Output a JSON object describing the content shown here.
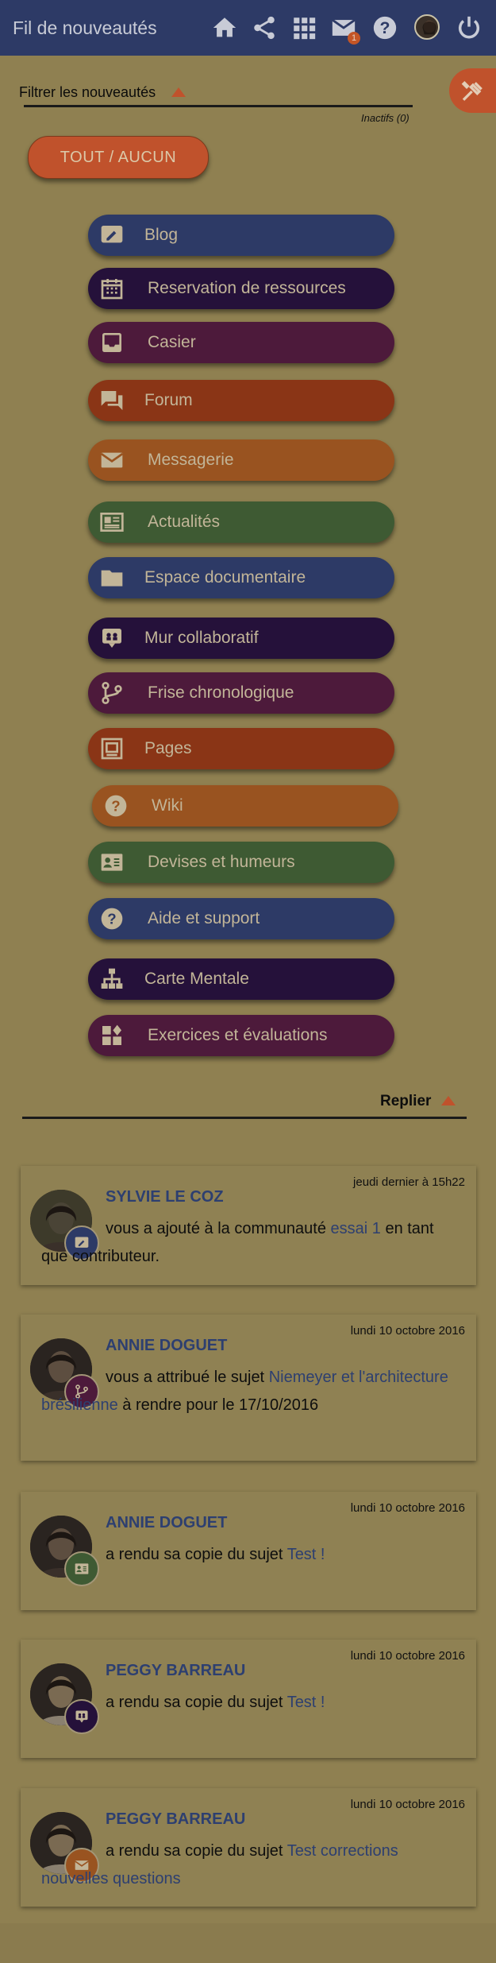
{
  "header": {
    "title": "Fil de nouveautés",
    "mail_badge": "1"
  },
  "filter": {
    "label": "Filtrer les nouveautés",
    "inactive": "Inactifs (0)",
    "toggle_all": "TOUT / AUCUN"
  },
  "apps": [
    {
      "label": "Blog",
      "icon": "blog-icon",
      "color": "#2d3a66"
    },
    {
      "label": "Reservation de ressources",
      "icon": "calendar-icon",
      "color": "#25113a"
    },
    {
      "label": "Casier",
      "icon": "inbox-icon",
      "color": "#4d1a3b"
    },
    {
      "label": "Forum",
      "icon": "forum-icon",
      "color": "#8a3516"
    },
    {
      "label": "Messagerie",
      "icon": "mail-icon",
      "color": "#995320"
    },
    {
      "label": "Actualités",
      "icon": "news-icon",
      "color": "#3e5a33"
    },
    {
      "label": "Espace documentaire",
      "icon": "folder-icon",
      "color": "#2d3a66"
    },
    {
      "label": "Mur collaboratif",
      "icon": "collab-wall-icon",
      "color": "#25113a"
    },
    {
      "label": "Frise chronologique",
      "icon": "timeline-icon",
      "color": "#4d1a3b"
    },
    {
      "label": "Pages",
      "icon": "pages-icon",
      "color": "#8a3516"
    },
    {
      "label": "Wiki",
      "icon": "wiki-icon",
      "color": "#995320"
    },
    {
      "label": "Devises et humeurs",
      "icon": "mood-icon",
      "color": "#3e5a33"
    },
    {
      "label": "Aide et support",
      "icon": "help-icon",
      "color": "#2d3a66"
    },
    {
      "label": "Carte Mentale",
      "icon": "mindmap-icon",
      "color": "#25113a"
    },
    {
      "label": "Exercices et évaluations",
      "icon": "exercises-icon",
      "color": "#4d1a3b"
    }
  ],
  "collapse": {
    "label": "Replier"
  },
  "feed": [
    {
      "date": "jeudi dernier à 15h22",
      "author": "SYLVIE LE COZ",
      "text_before": "vous a ajouté à la communauté ",
      "link": "essai 1",
      "text_after": " en tant que contributeur.",
      "app_icon": "blog-icon",
      "app_color": "#2d3a66"
    },
    {
      "date": "lundi 10 octobre 2016",
      "author": "ANNIE DOGUET",
      "text_before": "vous a attribué le sujet ",
      "link": "Niemeyer et l'architecture brésilienne",
      "text_after": " à rendre pour le 17/10/2016",
      "app_icon": "timeline-icon",
      "app_color": "#4d1a3b"
    },
    {
      "date": "lundi 10 octobre 2016",
      "author": "ANNIE DOGUET",
      "text_before": "a rendu sa copie du sujet ",
      "link": "Test !",
      "text_after": "",
      "app_icon": "mood-icon",
      "app_color": "#3e5a33"
    },
    {
      "date": "lundi 10 octobre 2016",
      "author": "PEGGY BARREAU",
      "text_before": "a rendu sa copie du sujet ",
      "link": "Test !",
      "text_after": "",
      "app_icon": "collab-wall-icon",
      "app_color": "#25113a"
    },
    {
      "date": "lundi 10 octobre 2016",
      "author": "PEGGY BARREAU",
      "text_before": "a rendu sa copie du sujet ",
      "link": "Test corrections nouvelles questions",
      "text_after": "",
      "app_icon": "mail-icon",
      "app_color": "#995320"
    }
  ],
  "colors": {
    "background": "#8f8051",
    "topbar": "#2d3a66",
    "accent": "#c0522c",
    "link": "#2d3f70"
  }
}
